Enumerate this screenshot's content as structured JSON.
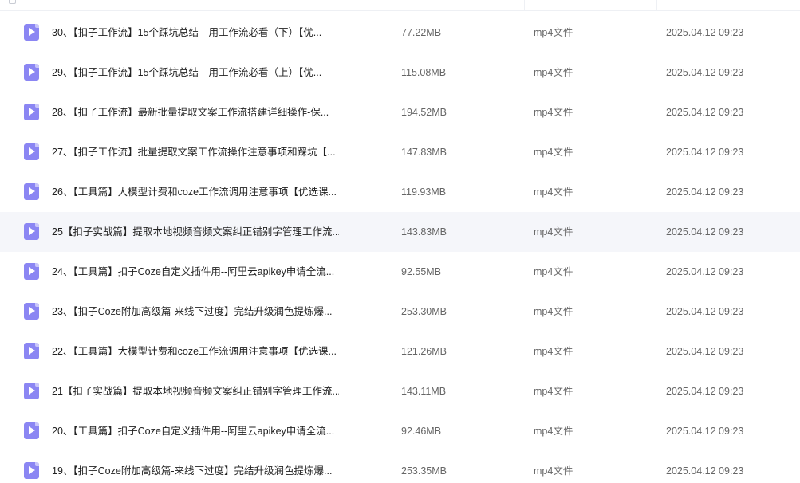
{
  "files": [
    {
      "name": "30、【扣子工作流】15个踩坑总结---用工作流必看（下）【优...",
      "size": "77.22MB",
      "type": "mp4文件",
      "date": "2025.04.12 09:23"
    },
    {
      "name": "29、【扣子工作流】15个踩坑总结---用工作流必看（上）【优...",
      "size": "115.08MB",
      "type": "mp4文件",
      "date": "2025.04.12 09:23"
    },
    {
      "name": "28、【扣子工作流】最新批量提取文案工作流搭建详细操作-保...",
      "size": "194.52MB",
      "type": "mp4文件",
      "date": "2025.04.12 09:23"
    },
    {
      "name": "27、【扣子工作流】批量提取文案工作流操作注意事项和踩坑【...",
      "size": "147.83MB",
      "type": "mp4文件",
      "date": "2025.04.12 09:23"
    },
    {
      "name": "26、【工具篇】大模型计费和coze工作流调用注意事项【优选课...",
      "size": "119.93MB",
      "type": "mp4文件",
      "date": "2025.04.12 09:23"
    },
    {
      "name": "25【扣子实战篇】提取本地视频音频文案纠正错别字管理工作流...",
      "size": "143.83MB",
      "type": "mp4文件",
      "date": "2025.04.12 09:23"
    },
    {
      "name": "24、【工具篇】扣子Coze自定义插件用--阿里云apikey申请全流...",
      "size": "92.55MB",
      "type": "mp4文件",
      "date": "2025.04.12 09:23"
    },
    {
      "name": "23、【扣子Coze附加高级篇-来线下过度】完结升级润色提炼爆...",
      "size": "253.30MB",
      "type": "mp4文件",
      "date": "2025.04.12 09:23"
    },
    {
      "name": "22、【工具篇】大模型计费和coze工作流调用注意事项【优选课...",
      "size": "121.26MB",
      "type": "mp4文件",
      "date": "2025.04.12 09:23"
    },
    {
      "name": "21【扣子实战篇】提取本地视频音频文案纠正错别字管理工作流...",
      "size": "143.11MB",
      "type": "mp4文件",
      "date": "2025.04.12 09:23"
    },
    {
      "name": "20、【工具篇】扣子Coze自定义插件用--阿里云apikey申请全流...",
      "size": "92.46MB",
      "type": "mp4文件",
      "date": "2025.04.12 09:23"
    },
    {
      "name": "19、【扣子Coze附加高级篇-来线下过度】完结升级润色提炼爆...",
      "size": "253.35MB",
      "type": "mp4文件",
      "date": "2025.04.12 09:23"
    }
  ],
  "hovered_row": 5,
  "icons": {
    "file": "video-file-icon"
  },
  "colors": {
    "icon_accent": "#8b86f3",
    "hover_bg": "#f5f6fa",
    "text_primary": "#222222",
    "text_secondary": "#666666"
  }
}
